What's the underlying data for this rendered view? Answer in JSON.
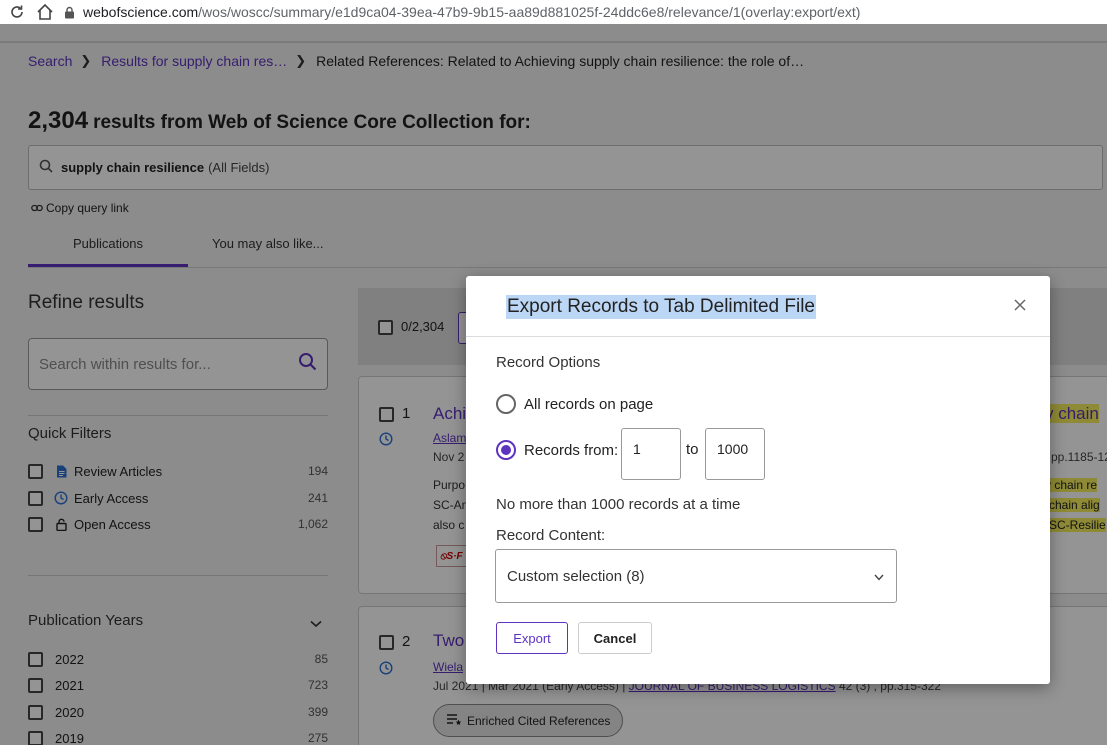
{
  "browser": {
    "url_host": "webofscience.com",
    "url_path": "/wos/woscc/summary/e1d9ca04-39ea-47b9-9b15-aa89d881025f-24ddc6e8/relevance/1(overlay:export/ext)"
  },
  "breadcrumb": {
    "search": "Search",
    "results": "Results for supply chain res…",
    "current": "Related References: Related to Achieving supply chain resilience: the role of…"
  },
  "results_header": {
    "count": "2,304",
    "text": "results from Web of Science Core Collection for:"
  },
  "query": {
    "term": "supply chain resilience",
    "field": "(All Fields)"
  },
  "copy_query_link": "Copy query link",
  "tabs": {
    "publications": "Publications",
    "may_like": "You may also like..."
  },
  "sidebar": {
    "refine_title": "Refine results",
    "search_placeholder": "Search within results for...",
    "quick_filters_title": "Quick Filters",
    "quick_filters": [
      {
        "label": "Review Articles",
        "count": "194",
        "icon": "document-icon"
      },
      {
        "label": "Early Access",
        "count": "241",
        "icon": "clock-icon"
      },
      {
        "label": "Open Access",
        "count": "1,062",
        "icon": "lock-icon"
      }
    ],
    "publication_years_title": "Publication Years",
    "years": [
      {
        "label": "2022",
        "count": "85"
      },
      {
        "label": "2021",
        "count": "723"
      },
      {
        "label": "2020",
        "count": "399"
      },
      {
        "label": "2019",
        "count": "275"
      }
    ]
  },
  "results": {
    "selected": "0/2,304",
    "records": [
      {
        "number": "1",
        "title_visible": "Achi",
        "title_right": "y chain",
        "authors_visible": "Aslam",
        "date_visible": "Nov 2",
        "pages_visible": "pp.1185-12",
        "abstract_lines": [
          "Purpo",
          "SC-An",
          "also c"
        ],
        "abstract_right": [
          "y chain re",
          "chain alig",
          "SC-Resilie"
        ]
      },
      {
        "number": "2",
        "title_visible": "Two",
        "authors_visible": "Wiela",
        "meta": "Jul 2021 | Mar 2021 (Early Access) |",
        "journal": "JOURNAL OF BUSINESS LOGISTICS",
        "volume": "42 (3) , pp.315-322",
        "enriched_label": "Enriched Cited References"
      }
    ]
  },
  "modal": {
    "title": "Export Records to Tab Delimited File",
    "record_options_label": "Record Options",
    "option_all": "All records on page",
    "option_range": "Records from:",
    "range_from": "1",
    "range_to": "1000",
    "to_label": "to",
    "limit_text": "No more than 1000 records at a time",
    "content_label": "Record Content:",
    "content_value": "Custom selection (8)",
    "export_label": "Export",
    "cancel_label": "Cancel"
  },
  "colors": {
    "accent": "#5e33bf",
    "highlight": "#f4ee5c",
    "title_selection": "#bcd7f5"
  }
}
